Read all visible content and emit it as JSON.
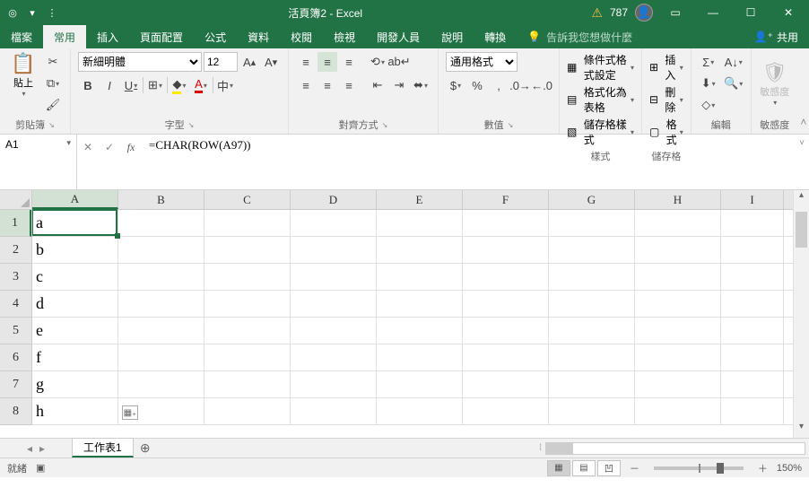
{
  "titlebar": {
    "title": "活頁簿2 - Excel",
    "points": "787"
  },
  "tabs": {
    "file": "檔案",
    "home": "常用",
    "insert": "插入",
    "pagelayout": "頁面配置",
    "formulas": "公式",
    "data": "資料",
    "review": "校閱",
    "view": "檢視",
    "developer": "開發人員",
    "help": "說明",
    "rotate": "轉換",
    "tellme": "告訴我您想做什麼",
    "share": "共用"
  },
  "ribbon": {
    "clipboard": {
      "label": "剪貼簿",
      "paste": "貼上"
    },
    "font": {
      "label": "字型",
      "name": "新細明體",
      "size": "12",
      "bold": "B",
      "italic": "I",
      "underline": "U"
    },
    "alignment": {
      "label": "對齊方式"
    },
    "number": {
      "label": "數值",
      "format": "通用格式"
    },
    "styles": {
      "label": "樣式",
      "cond": "條件式格式設定",
      "table": "格式化為表格",
      "cell": "儲存格樣式"
    },
    "cells": {
      "label": "儲存格",
      "insert": "插入",
      "delete": "刪除",
      "format": "格式"
    },
    "editing": {
      "label": "編輯"
    },
    "sensitivity": {
      "label": "敏感度",
      "btn": "敏感度"
    }
  },
  "formulabar": {
    "namebox": "A1",
    "formula": "=CHAR(ROW(A97))"
  },
  "grid": {
    "cols": [
      "A",
      "B",
      "C",
      "D",
      "E",
      "F",
      "G",
      "H",
      "I"
    ],
    "rows": [
      "1",
      "2",
      "3",
      "4",
      "5",
      "6",
      "7",
      "8"
    ],
    "data": {
      "A1": "a",
      "A2": "b",
      "A3": "c",
      "A4": "d",
      "A5": "e",
      "A6": "f",
      "A7": "g",
      "A8": "h"
    }
  },
  "sheets": {
    "tab1": "工作表1"
  },
  "statusbar": {
    "mode": "就緒",
    "zoom": "150%"
  }
}
